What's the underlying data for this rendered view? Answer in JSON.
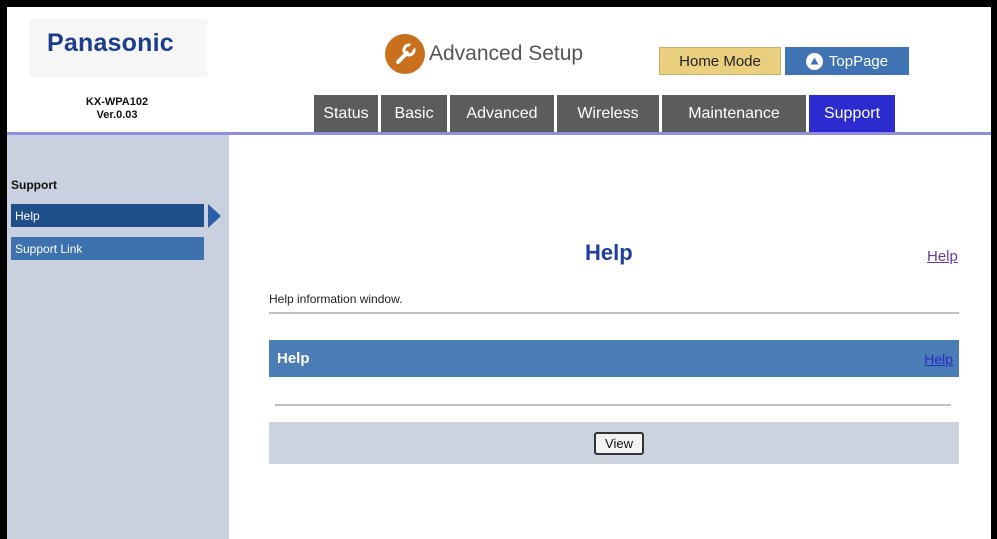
{
  "header": {
    "brand": "Panasonic",
    "model": "KX-WPA102",
    "version": "Ver.0.03",
    "advanced_setup": "Advanced Setup",
    "home_mode": "Home Mode",
    "top_page": "TopPage"
  },
  "tabs": [
    {
      "label": "Status",
      "active": false
    },
    {
      "label": "Basic",
      "active": false
    },
    {
      "label": "Advanced",
      "active": false
    },
    {
      "label": "Wireless",
      "active": false
    },
    {
      "label": "Maintenance",
      "active": false
    },
    {
      "label": "Support",
      "active": true
    }
  ],
  "sidebar": {
    "title": "Support",
    "items": [
      {
        "label": "Help",
        "active": true
      },
      {
        "label": "Support Link",
        "active": false
      }
    ]
  },
  "main": {
    "title": "Help",
    "help_link": "Help",
    "info": "Help information window.",
    "section_title": "Help",
    "section_link": "Help",
    "view_button": "View"
  },
  "colors": {
    "brand": "#1c3c8c",
    "tab_inactive": "#5c5c5c",
    "tab_active": "#2b2bd0",
    "sidebar_bg": "#c9d0df",
    "section_bar": "#4a7cb6"
  },
  "icons": {
    "advanced_setup": "wrench-icon",
    "top_page": "up-arrow-circle-icon",
    "sidebar_selection": "triangle-right-icon"
  }
}
